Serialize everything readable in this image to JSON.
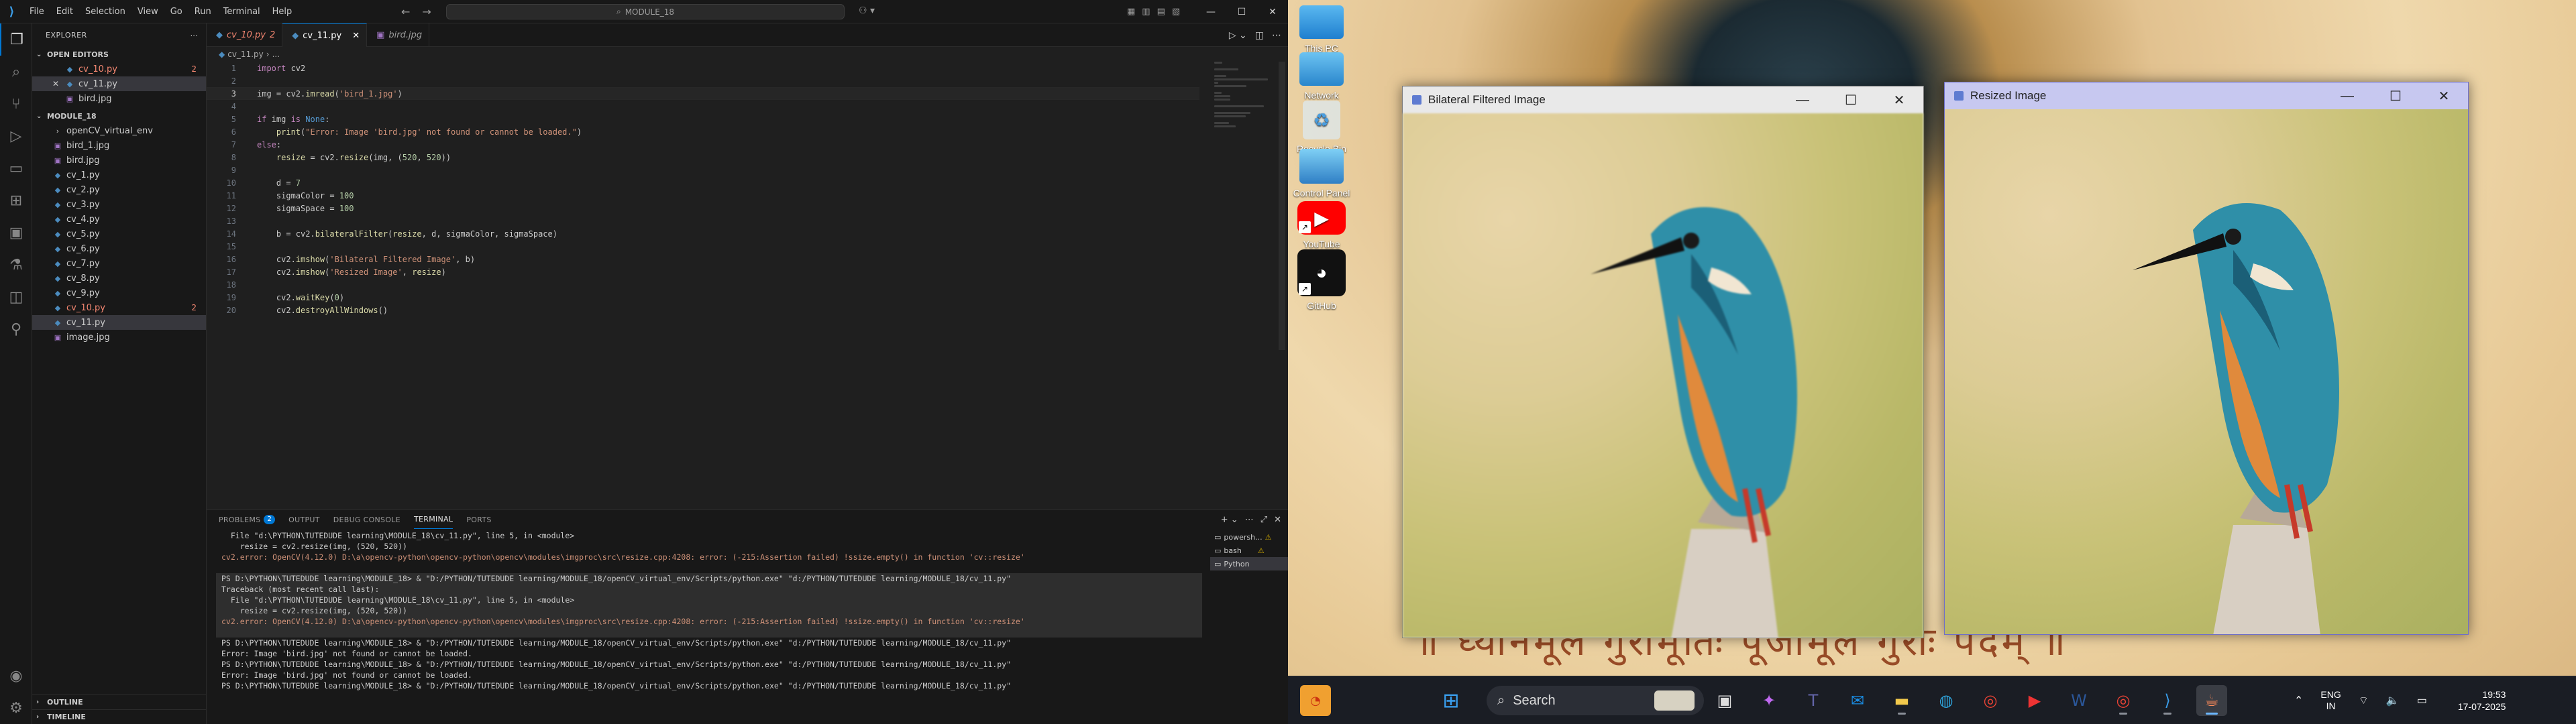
{
  "vscode": {
    "menu": [
      "File",
      "Edit",
      "Selection",
      "View",
      "Go",
      "Run",
      "Terminal",
      "Help"
    ],
    "command_center": "MODULE_18",
    "sidebar": {
      "title": "EXPLORER",
      "open_editors_title": "OPEN EDITORS",
      "open_editors": [
        {
          "name": "cv_10.py",
          "badge": "2",
          "error": true
        },
        {
          "name": "cv_11.py",
          "badge": "",
          "error": false
        },
        {
          "name": "bird.jpg",
          "badge": "",
          "error": false
        }
      ],
      "folder_title": "MODULE_18",
      "files": [
        {
          "name": "openCV_virtual_env",
          "kind": "folder",
          "badge": ""
        },
        {
          "name": "bird_1.jpg",
          "kind": "img",
          "badge": ""
        },
        {
          "name": "bird.jpg",
          "kind": "img",
          "badge": ""
        },
        {
          "name": "cv_1.py",
          "kind": "py",
          "badge": ""
        },
        {
          "name": "cv_2.py",
          "kind": "py",
          "badge": ""
        },
        {
          "name": "cv_3.py",
          "kind": "py",
          "badge": ""
        },
        {
          "name": "cv_4.py",
          "kind": "py",
          "badge": ""
        },
        {
          "name": "cv_5.py",
          "kind": "py",
          "badge": ""
        },
        {
          "name": "cv_6.py",
          "kind": "py",
          "badge": ""
        },
        {
          "name": "cv_7.py",
          "kind": "py",
          "badge": ""
        },
        {
          "name": "cv_8.py",
          "kind": "py",
          "badge": ""
        },
        {
          "name": "cv_9.py",
          "kind": "py",
          "badge": ""
        },
        {
          "name": "cv_10.py",
          "kind": "py",
          "badge": "2",
          "error": true
        },
        {
          "name": "cv_11.py",
          "kind": "py",
          "badge": "",
          "selected": true
        },
        {
          "name": "image.jpg",
          "kind": "img",
          "badge": ""
        }
      ],
      "outline": "OUTLINE",
      "timeline": "TIMELINE"
    },
    "tabs": [
      {
        "label": "cv_10.py",
        "suffix": "2",
        "error": true,
        "active": false
      },
      {
        "label": "cv_11.py",
        "suffix": "",
        "error": false,
        "active": true
      },
      {
        "label": "bird.jpg",
        "suffix": "",
        "error": false,
        "active": false
      }
    ],
    "breadcrumb": [
      "cv_11.py",
      "..."
    ],
    "code_lines": [
      "import cv2",
      "",
      "img = cv2.imread('bird_1.jpg')",
      "",
      "if img is None:",
      "    print(\"Error: Image 'bird.jpg' not found or cannot be loaded.\")",
      "else:",
      "    resize = cv2.resize(img, (520, 520))",
      "",
      "    d = 7",
      "    sigmaColor = 100",
      "    sigmaSpace = 100",
      "",
      "    b = cv2.bilateralFilter(resize, d, sigmaColor, sigmaSpace)",
      "",
      "    cv2.imshow('Bilateral Filtered Image', b)",
      "    cv2.imshow('Resized Image', resize)",
      "",
      "    cv2.waitKey(0)",
      "    cv2.destroyAllWindows()"
    ],
    "current_line": 3,
    "panel_tabs": [
      {
        "label": "PROBLEMS",
        "badge": "2"
      },
      {
        "label": "OUTPUT",
        "badge": ""
      },
      {
        "label": "DEBUG CONSOLE",
        "badge": ""
      },
      {
        "label": "TERMINAL",
        "badge": "",
        "active": true
      },
      {
        "label": "PORTS",
        "badge": ""
      }
    ],
    "terminal_lines": [
      {
        "text": "  File \"d:\\PYTHON\\TUTEDUDE learning\\MODULE_18\\cv_11.py\", line 5, in <module>",
        "cls": "",
        "hl": false
      },
      {
        "text": "    resize = cv2.resize(img, (520, 520))",
        "cls": "",
        "hl": false
      },
      {
        "text": "cv2.error: OpenCV(4.12.0) D:\\a\\opencv-python\\opencv-python\\opencv\\modules\\imgproc\\src\\resize.cpp:4208: error: (-215:Assertion failed) !ssize.empty() in function 'cv::resize'",
        "cls": "t-err",
        "hl": false
      },
      {
        "text": "",
        "cls": "",
        "hl": false
      },
      {
        "text": "PS D:\\PYTHON\\TUTEDUDE learning\\MODULE_18> & \"D:/PYTHON/TUTEDUDE learning/MODULE_18/openCV_virtual_env/Scripts/python.exe\" \"d:/PYTHON/TUTEDUDE learning/MODULE_18/cv_11.py\"",
        "cls": "",
        "hl": true
      },
      {
        "text": "Traceback (most recent call last):",
        "cls": "",
        "hl": true
      },
      {
        "text": "  File \"d:\\PYTHON\\TUTEDUDE learning\\MODULE_18\\cv_11.py\", line 5, in <module>",
        "cls": "",
        "hl": true
      },
      {
        "text": "    resize = cv2.resize(img, (520, 520))",
        "cls": "",
        "hl": true
      },
      {
        "text": "cv2.error: OpenCV(4.12.0) D:\\a\\opencv-python\\opencv-python\\opencv\\modules\\imgproc\\src\\resize.cpp:4208: error: (-215:Assertion failed) !ssize.empty() in function 'cv::resize'",
        "cls": "t-err",
        "hl": true
      },
      {
        "text": "",
        "cls": "",
        "hl": true
      },
      {
        "text": "PS D:\\PYTHON\\TUTEDUDE learning\\MODULE_18> & \"D:/PYTHON/TUTEDUDE learning/MODULE_18/openCV_virtual_env/Scripts/python.exe\" \"d:/PYTHON/TUTEDUDE learning/MODULE_18/cv_11.py\"",
        "cls": "",
        "hl": false
      },
      {
        "text": "Error: Image 'bird.jpg' not found or cannot be loaded.",
        "cls": "",
        "hl": false
      },
      {
        "text": "PS D:\\PYTHON\\TUTEDUDE learning\\MODULE_18> & \"D:/PYTHON/TUTEDUDE learning/MODULE_18/openCV_virtual_env/Scripts/python.exe\" \"d:/PYTHON/TUTEDUDE learning/MODULE_18/cv_11.py\"",
        "cls": "",
        "hl": false
      },
      {
        "text": "Error: Image 'bird.jpg' not found or cannot be loaded.",
        "cls": "",
        "hl": false
      },
      {
        "text": "PS D:\\PYTHON\\TUTEDUDE learning\\MODULE_18> & \"D:/PYTHON/TUTEDUDE learning/MODULE_18/openCV_virtual_env/Scripts/python.exe\" \"d:/PYTHON/TUTEDUDE learning/MODULE_18/cv_11.py\"",
        "cls": "",
        "hl": false
      },
      {
        "text": "",
        "cls": "",
        "hl": false
      }
    ],
    "terminal_list": [
      {
        "label": "powersh...",
        "warn": true
      },
      {
        "label": "bash",
        "warn": true
      },
      {
        "label": "Python",
        "warn": false,
        "active": true
      }
    ]
  },
  "desktop": {
    "icons": [
      "This PC",
      "Network",
      "Recycle Bin",
      "Control Panel",
      "YouTube",
      "GitHub"
    ],
    "windows": [
      {
        "title": "Bilateral Filtered Image",
        "active": false
      },
      {
        "title": "Resized Image",
        "active": true
      }
    ],
    "taskbar": {
      "search_placeholder": "Search",
      "language": "ENG",
      "region": "IN",
      "time": "19:53",
      "date": "17-07-2025"
    }
  },
  "colors": {
    "accent": "#0078d4",
    "error": "#f48771",
    "editor_bg": "#1f1f1f"
  }
}
